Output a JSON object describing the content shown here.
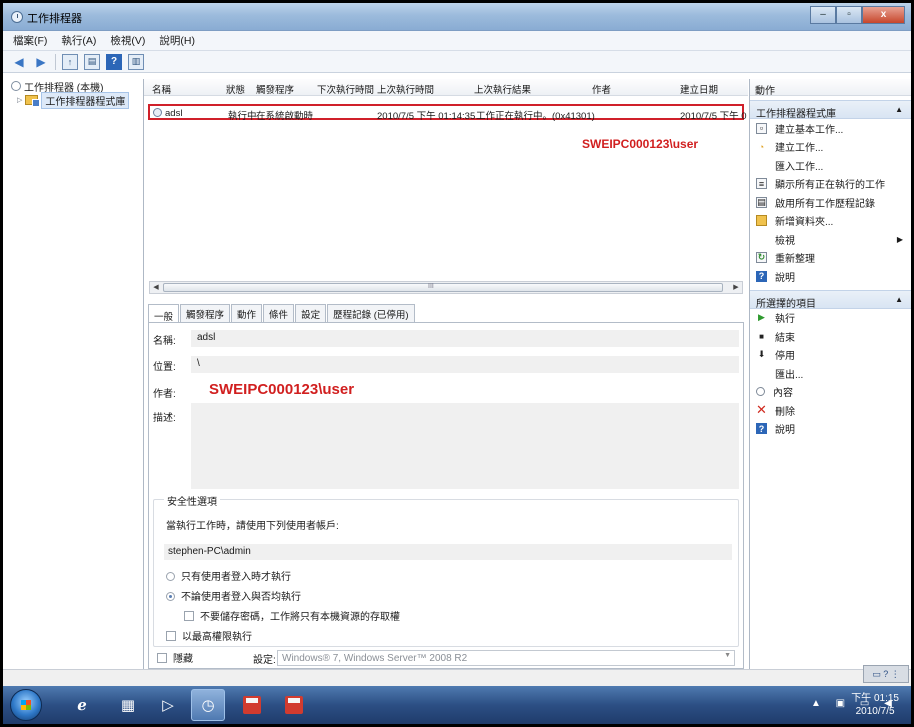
{
  "window": {
    "title": "工作排程器",
    "minimize": "–",
    "maximize": "▫",
    "close": "x"
  },
  "menubar": [
    "檔案(F)",
    "執行(A)",
    "檢視(V)",
    "說明(H)"
  ],
  "tree": {
    "root": "工作排程器 (本機)",
    "child": "工作排程器程式庫"
  },
  "grid": {
    "columns": [
      "名稱",
      "狀態",
      "觸發程序",
      "下次執行時間",
      "上次執行時間",
      "上次執行結果",
      "作者",
      "建立日期"
    ],
    "row": [
      "adsl",
      "執行中",
      "在系統啟動時",
      "",
      "2010/7/5 下午 01:14:35",
      "工作正在執行中。(0x41301)",
      "",
      "2010/7/5 下午 0"
    ],
    "annotation": "SWEIPC000123\\user",
    "scroll_grip": "III"
  },
  "tabs": [
    "一般",
    "觸發程序",
    "動作",
    "條件",
    "設定",
    "歷程記錄 (已停用)"
  ],
  "general": {
    "name_label": "名稱:",
    "name_value": "adsl",
    "location_label": "位置:",
    "location_value": "\\",
    "author_label": "作者:",
    "author_value": "SWEIPC000123\\user",
    "desc_label": "描述:"
  },
  "security": {
    "legend": "安全性選項",
    "prompt": "當執行工作時，請使用下列使用者帳戶:",
    "account": "stephen-PC\\admin",
    "radio1": "只有使用者登入時才執行",
    "radio2": "不論使用者登入與否均執行",
    "no_password": "不要儲存密碼，工作將只有本機資源的存取權",
    "highest": "以最高權限執行"
  },
  "bottom": {
    "hidden_label": "隱藏",
    "config_label": "設定:",
    "config_value": "Windows® 7, Windows Server™ 2008 R2"
  },
  "actions": {
    "header": "動作",
    "section1": "工作排程器程式庫",
    "items1": [
      "建立基本工作...",
      "建立工作...",
      "匯入工作...",
      "顯示所有正在執行的工作",
      "啟用所有工作歷程記錄",
      "新增資料夾...",
      "檢視",
      "重新整理",
      "說明"
    ],
    "section2": "所選擇的項目",
    "items2": [
      "執行",
      "結束",
      "停用",
      "匯出...",
      "內容",
      "刪除",
      "說明"
    ]
  },
  "tray": {
    "time": "下午 01:15",
    "date": "2010/7/5"
  },
  "colors": {
    "annotation": "#d11f1f",
    "highlight_border": "#d0202a",
    "taskbar": "#2c4f84"
  }
}
